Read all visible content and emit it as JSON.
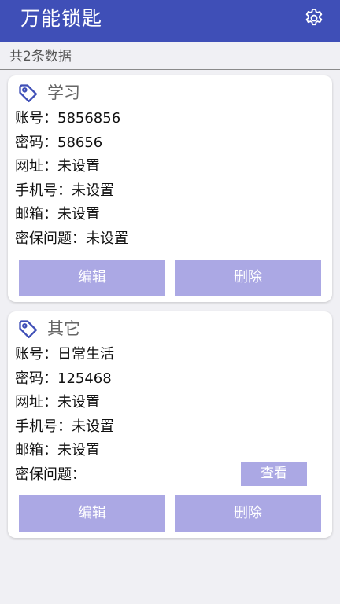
{
  "app": {
    "title": "万能锁匙"
  },
  "summary": {
    "count_text": "共2条数据"
  },
  "entries": [
    {
      "category": "学习",
      "fields": [
        {
          "label": "账号：",
          "value": "5856856"
        },
        {
          "label": "密码：",
          "value": "58656"
        },
        {
          "label": "网址：",
          "value": "未设置"
        },
        {
          "label": "手机号：",
          "value": "未设置"
        },
        {
          "label": "邮箱：",
          "value": "未设置"
        },
        {
          "label": "密保问题：",
          "value": "未设置"
        }
      ],
      "edit_label": "编辑",
      "delete_label": "删除"
    },
    {
      "category": "其它",
      "fields": [
        {
          "label": "账号：",
          "value": "日常生活"
        },
        {
          "label": "密码：",
          "value": "125468"
        },
        {
          "label": "网址：",
          "value": "未设置"
        },
        {
          "label": "手机号：",
          "value": "未设置"
        },
        {
          "label": "邮箱：",
          "value": "未设置"
        },
        {
          "label": "密保问题：",
          "value": ""
        }
      ],
      "view_label": "查看",
      "edit_label": "编辑",
      "delete_label": "删除"
    }
  ],
  "colors": {
    "appbar": "#3f4fb7",
    "button": "#aba8e4",
    "tag_icon": "#3f4fb7"
  },
  "icons": {
    "settings": "gear-icon",
    "category": "tag-icon"
  }
}
